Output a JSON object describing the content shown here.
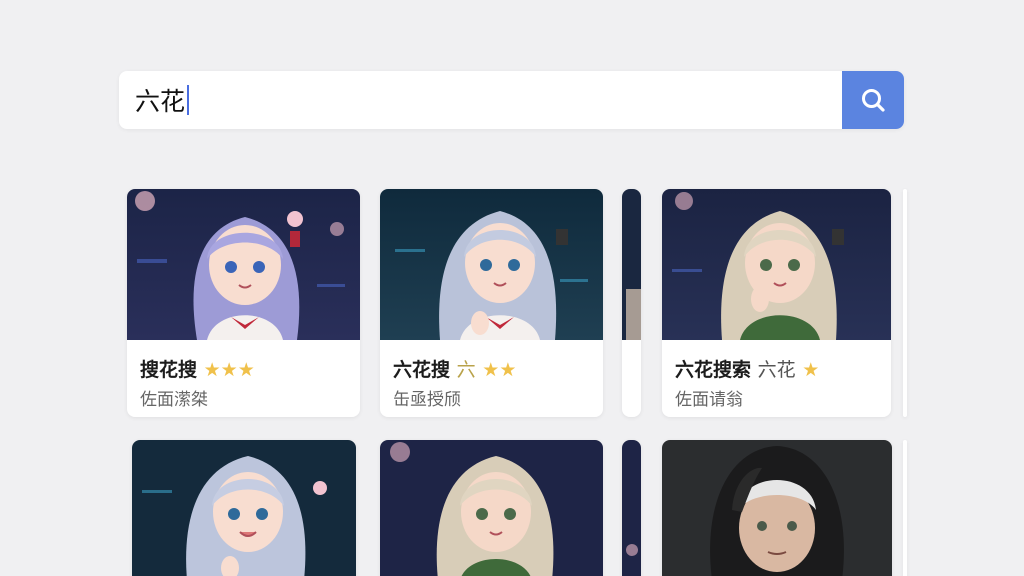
{
  "search": {
    "query": "六花",
    "button_icon": "search-icon",
    "button_color": "#5b84e0"
  },
  "results": [
    {
      "title": "搜花搜",
      "extra": "",
      "stars": "★★★",
      "subtitle": "佐面潆桀"
    },
    {
      "title": "六花搜",
      "extra": "六",
      "stars": "★★",
      "subtitle": "缶亟授颀"
    },
    {
      "title": "六花搜索",
      "extra": "六花",
      "stars": "★",
      "subtitle": "佐面请翁"
    }
  ],
  "colors": {
    "accent": "#5b84e0",
    "star": "#f0c14b",
    "background": "#f0f0f2"
  }
}
